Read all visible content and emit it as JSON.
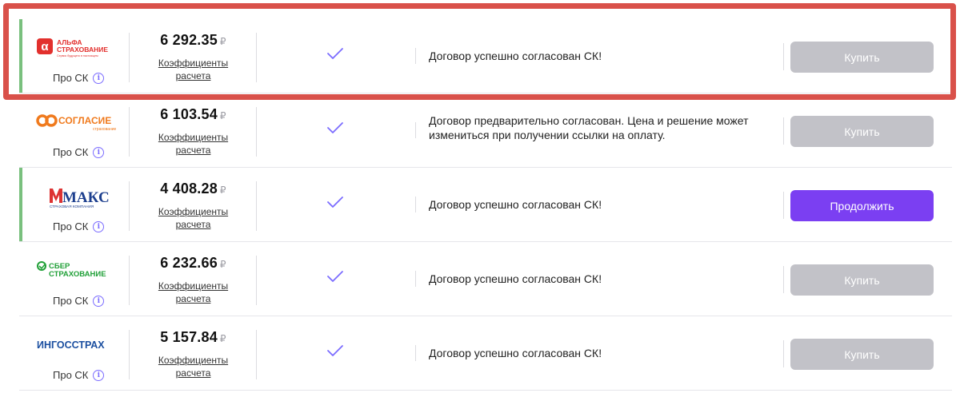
{
  "currency_symbol": "₽",
  "offers": [
    {
      "company": "alfa",
      "logo": {
        "line1": "АЛЬФА",
        "line2": "СТРАХОВАНИЕ",
        "tagline": "Сервис будущего в настоящем",
        "color": "#e2302d"
      },
      "about_label": "Про СК",
      "price": "6 292.35",
      "coef_label": "Коэффициенты расчета",
      "status": "Договор успешно согласован СК!",
      "button": "Купить",
      "button_active": false,
      "accent": true
    },
    {
      "company": "soglasie",
      "logo": {
        "line1": "СОГЛАСИЕ",
        "line2": "страхование",
        "color": "#f07a1d"
      },
      "about_label": "Про СК",
      "price": "6 103.54",
      "coef_label": "Коэффициенты расчета",
      "status": "Договор предварительно согласован. Цена и решение может измениться при получении ссылки на оплату.",
      "button": "Купить",
      "button_active": false,
      "accent": false
    },
    {
      "company": "maks",
      "logo": {
        "line1": "МАКС",
        "line2": "СТРАХОВАЯ КОМПАНИЯ",
        "color": "#1d3f8e"
      },
      "about_label": "Про СК",
      "price": "4 408.28",
      "coef_label": "Коэффициенты расчета",
      "status": "Договор успешно согласован СК!",
      "button": "Продолжить",
      "button_active": true,
      "accent": true
    },
    {
      "company": "sber",
      "logo": {
        "line1": "СБЕР",
        "line2": "СТРАХОВАНИЕ",
        "color": "#21a038"
      },
      "about_label": "Про СК",
      "price": "6 232.66",
      "coef_label": "Коэффициенты расчета",
      "status": "Договор успешно согласован СК!",
      "button": "Купить",
      "button_active": false,
      "accent": false
    },
    {
      "company": "ingos",
      "logo": {
        "line1": "ИНГОССТРАХ",
        "color": "#1b4fa0"
      },
      "about_label": "Про СК",
      "price": "5 157.84",
      "coef_label": "Коэффициенты расчета",
      "status": "Договор успешно согласован СК!",
      "button": "Купить",
      "button_active": false,
      "accent": false
    }
  ],
  "colors": {
    "accent_bar": "#79c07e",
    "check": "#7b6cff",
    "button_primary": "#7b3ff2",
    "button_disabled": "#c2c2c8",
    "highlight": "#d9514a"
  }
}
